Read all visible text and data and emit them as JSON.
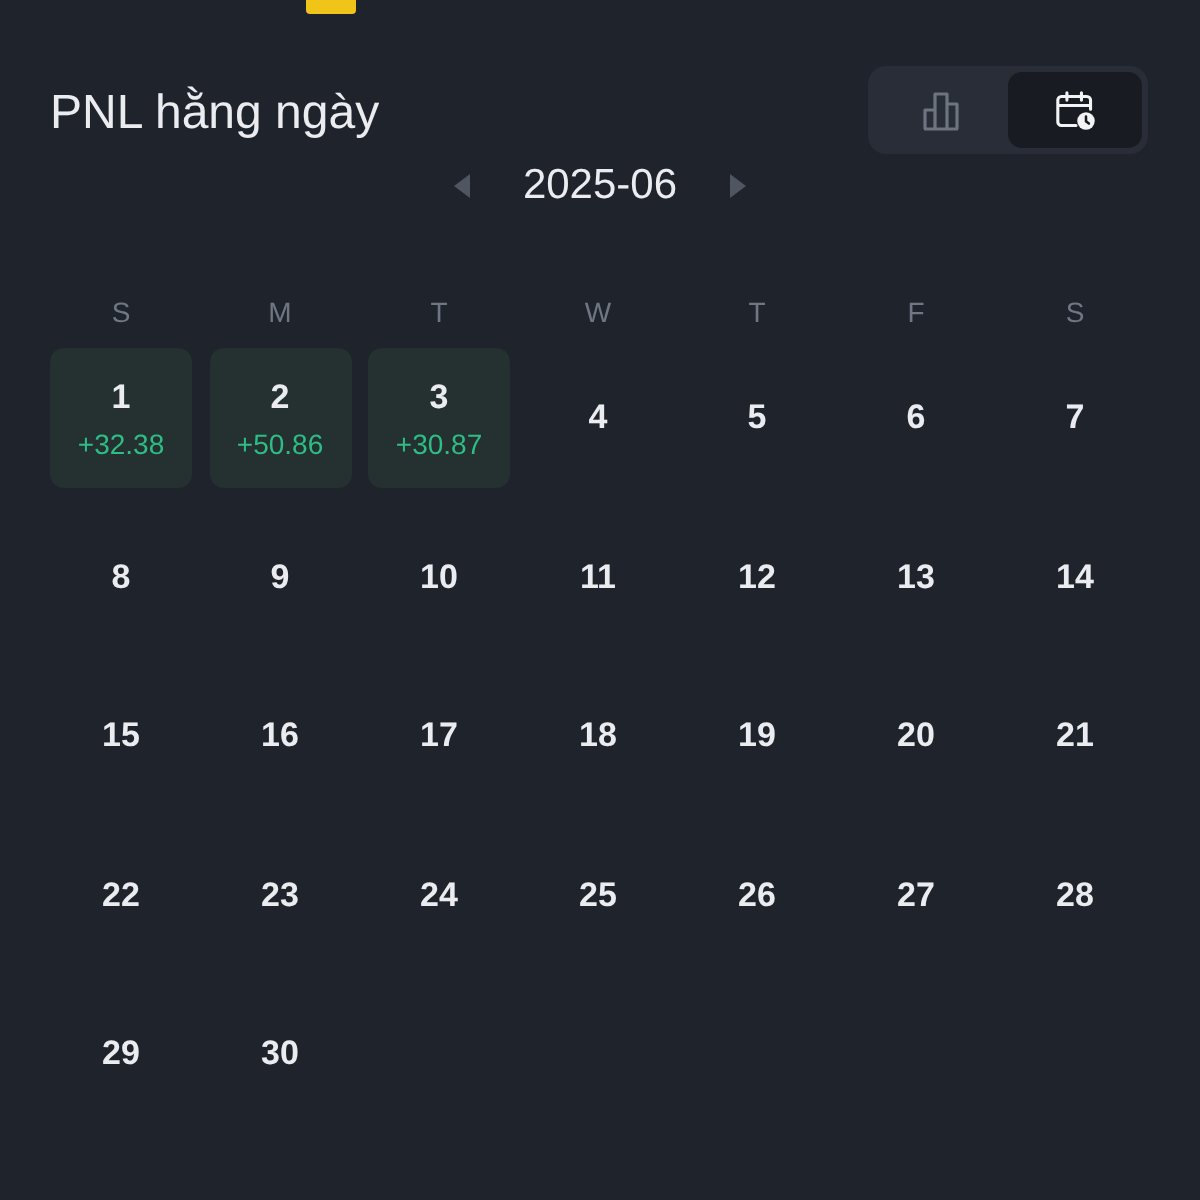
{
  "title": "PNL hằng ngày",
  "view_toggle": [
    {
      "kind": "chart",
      "selected": false
    },
    {
      "kind": "calendar",
      "selected": true
    }
  ],
  "month_nav": {
    "month": "2025-06"
  },
  "weekdays": [
    "S",
    "M",
    "T",
    "W",
    "T",
    "F",
    "S"
  ],
  "days": [
    {
      "day": "1",
      "pnl": "+32.38"
    },
    {
      "day": "2",
      "pnl": "+50.86"
    },
    {
      "day": "3",
      "pnl": "+30.87"
    },
    {
      "day": "4"
    },
    {
      "day": "5"
    },
    {
      "day": "6"
    },
    {
      "day": "7"
    },
    {
      "day": "8"
    },
    {
      "day": "9"
    },
    {
      "day": "10"
    },
    {
      "day": "11"
    },
    {
      "day": "12"
    },
    {
      "day": "13"
    },
    {
      "day": "14"
    },
    {
      "day": "15"
    },
    {
      "day": "16"
    },
    {
      "day": "17"
    },
    {
      "day": "18"
    },
    {
      "day": "19"
    },
    {
      "day": "20"
    },
    {
      "day": "21"
    },
    {
      "day": "22"
    },
    {
      "day": "23"
    },
    {
      "day": "24"
    },
    {
      "day": "25"
    },
    {
      "day": "26"
    },
    {
      "day": "27"
    },
    {
      "day": "28"
    },
    {
      "day": "29"
    },
    {
      "day": "30"
    }
  ]
}
